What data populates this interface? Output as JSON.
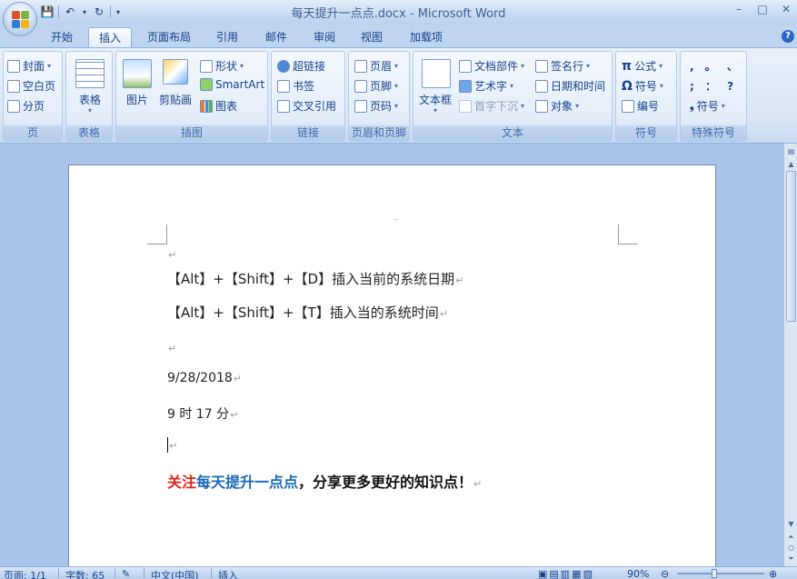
{
  "titlebar": {
    "title": "每天提升一点点.docx - Microsoft Word",
    "minimize_glyph": "–",
    "maximize_glyph": "□",
    "close_glyph": "✕"
  },
  "quick_access": {
    "save_glyph": "💾",
    "undo_glyph": "↶",
    "redo_glyph": "↻",
    "customize_glyph": "▾"
  },
  "tabs": [
    {
      "label": "开始"
    },
    {
      "label": "插入"
    },
    {
      "label": "页面布局"
    },
    {
      "label": "引用"
    },
    {
      "label": "邮件"
    },
    {
      "label": "审阅"
    },
    {
      "label": "视图"
    },
    {
      "label": "加载项"
    }
  ],
  "active_tab": "插入",
  "ribbon": {
    "pages": {
      "label": "页",
      "cover": "封面",
      "blank": "空白页",
      "break": "分页"
    },
    "tables": {
      "label": "表格",
      "table": "表格"
    },
    "illustrations": {
      "label": "插图",
      "picture": "图片",
      "clipart": "剪贴画",
      "shapes": "形状",
      "smartart": "SmartArt",
      "chart": "图表"
    },
    "links": {
      "label": "链接",
      "hyperlink": "超链接",
      "bookmark": "书签",
      "crossref": "交叉引用"
    },
    "header_footer": {
      "label": "页眉和页脚",
      "header": "页眉",
      "footer": "页脚",
      "pagenum": "页码"
    },
    "text": {
      "label": "文本",
      "textbox": "文本框",
      "quickparts": "文档部件",
      "wordart": "艺术字",
      "dropcap": "首字下沉",
      "signature": "签名行",
      "datetime": "日期和时间",
      "object": "对象"
    },
    "symbols": {
      "label": "符号",
      "equation": "公式",
      "symbol": "符号",
      "number": "编号",
      "pi": "π",
      "omega": "Ω"
    },
    "special": {
      "label": "特殊符号",
      "r1": ",  。 、",
      "r2": ";  ：  ?",
      "symbol": "符号"
    }
  },
  "document": {
    "header_mark": "..",
    "lines": [
      "【Alt】+【Shift】+【D】插入当前的系统日期",
      "【Alt】+【Shift】+【T】插入当的系统时间",
      "9/28/2018",
      "9 时 17 分"
    ],
    "promo": {
      "part1": "关注",
      "part2": "每天提升一点点",
      "part3": "，分享更多更好的知识点！"
    },
    "para_mark": "↵"
  },
  "statusbar": {
    "page": "页面: 1/1",
    "words": "字数: 65",
    "lang": "中文(中国)",
    "mode": "插入",
    "zoom": "90%"
  },
  "colors": {
    "accent": "#15428b",
    "promo_red": "#e0241c",
    "promo_blue": "#1769b8"
  }
}
